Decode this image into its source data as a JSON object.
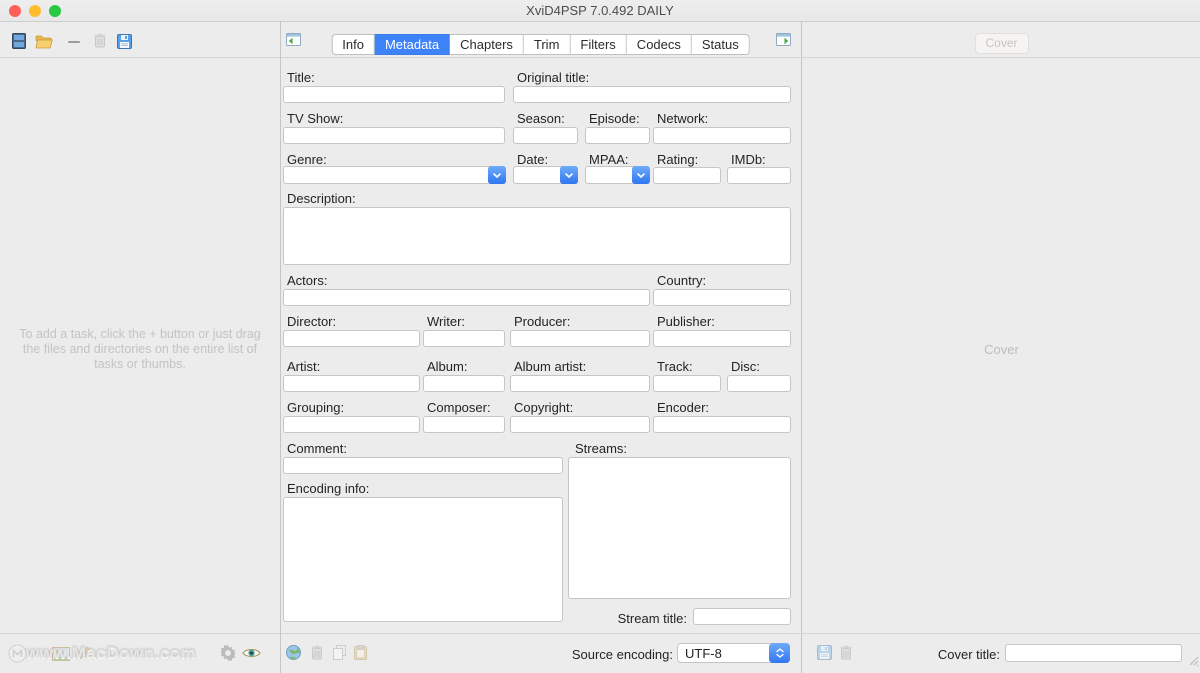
{
  "window": {
    "title": "XviD4PSP 7.0.492 DAILY"
  },
  "toolbar": {
    "tabs": [
      "Info",
      "Metadata",
      "Chapters",
      "Trim",
      "Filters",
      "Codecs",
      "Status"
    ],
    "active_tab": "Metadata",
    "cover_button_label": "Cover"
  },
  "left_panel": {
    "placeholder": "To add a task, click the + button or just drag the files and directories on the entire list of tasks or thumbs."
  },
  "right_panel": {
    "cover_placeholder": "Cover"
  },
  "metadata_form": {
    "title": {
      "label": "Title:",
      "value": ""
    },
    "original_title": {
      "label": "Original title:",
      "value": ""
    },
    "tv_show": {
      "label": "TV Show:",
      "value": ""
    },
    "season": {
      "label": "Season:",
      "value": ""
    },
    "episode": {
      "label": "Episode:",
      "value": ""
    },
    "network": {
      "label": "Network:",
      "value": ""
    },
    "genre": {
      "label": "Genre:",
      "value": ""
    },
    "date": {
      "label": "Date:",
      "value": ""
    },
    "mpaa": {
      "label": "MPAA:",
      "value": ""
    },
    "rating": {
      "label": "Rating:",
      "value": ""
    },
    "imdb": {
      "label": "IMDb:",
      "value": ""
    },
    "description": {
      "label": "Description:",
      "value": ""
    },
    "actors": {
      "label": "Actors:",
      "value": ""
    },
    "country": {
      "label": "Country:",
      "value": ""
    },
    "director": {
      "label": "Director:",
      "value": ""
    },
    "writer": {
      "label": "Writer:",
      "value": ""
    },
    "producer": {
      "label": "Producer:",
      "value": ""
    },
    "publisher": {
      "label": "Publisher:",
      "value": ""
    },
    "artist": {
      "label": "Artist:",
      "value": ""
    },
    "album": {
      "label": "Album:",
      "value": ""
    },
    "album_artist": {
      "label": "Album artist:",
      "value": ""
    },
    "track": {
      "label": "Track:",
      "value": ""
    },
    "disc": {
      "label": "Disc:",
      "value": ""
    },
    "grouping": {
      "label": "Grouping:",
      "value": ""
    },
    "composer": {
      "label": "Composer:",
      "value": ""
    },
    "copyright": {
      "label": "Copyright:",
      "value": ""
    },
    "encoder": {
      "label": "Encoder:",
      "value": ""
    },
    "comment": {
      "label": "Comment:",
      "value": ""
    },
    "encoding_info": {
      "label": "Encoding info:",
      "value": ""
    },
    "streams": {
      "label": "Streams:",
      "value": ""
    },
    "stream_title": {
      "label": "Stream title:",
      "value": ""
    }
  },
  "status_bar": {
    "source_encoding_label": "Source encoding:",
    "source_encoding_value": "UTF-8",
    "cover_title_label": "Cover title:",
    "cover_title_value": ""
  },
  "watermark": {
    "text": "www.MacDown.com"
  },
  "colors": {
    "accent_blue": "#3d82f7",
    "traffic_red": "#ff5f57",
    "traffic_yellow": "#febc2e",
    "traffic_green": "#28c840"
  }
}
